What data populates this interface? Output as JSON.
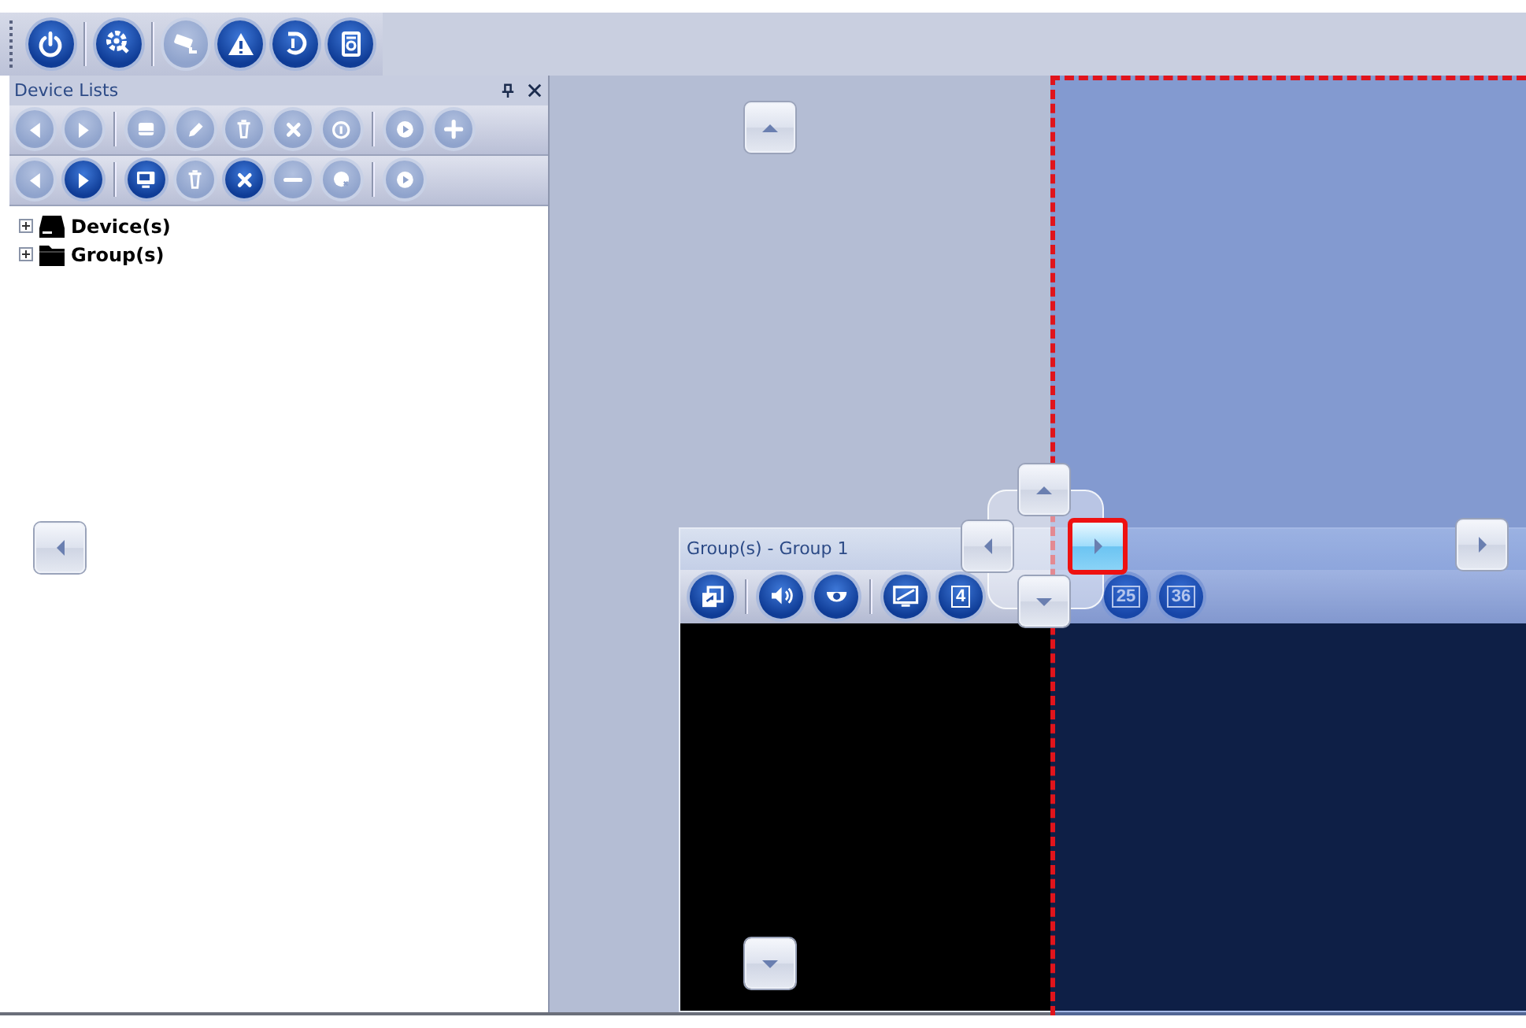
{
  "main_toolbar": {
    "groups": [
      {
        "buttons": [
          {
            "kind": "power",
            "disabled": false
          }
        ]
      },
      {
        "buttons": [
          {
            "kind": "settings",
            "disabled": false
          }
        ]
      },
      {
        "buttons": [
          {
            "kind": "camera",
            "disabled": true
          },
          {
            "kind": "warning",
            "disabled": false
          },
          {
            "kind": "playback",
            "disabled": false
          },
          {
            "kind": "disk",
            "disabled": false
          }
        ]
      }
    ]
  },
  "device_panel": {
    "title": "Device Lists",
    "toolbars": [
      {
        "groups": [
          {
            "buttons": [
              {
                "kind": "prev",
                "disabled": true
              },
              {
                "kind": "next",
                "disabled": true
              }
            ]
          },
          {
            "buttons": [
              {
                "kind": "device",
                "disabled": true
              },
              {
                "kind": "edit",
                "disabled": true
              },
              {
                "kind": "delete",
                "disabled": true
              },
              {
                "kind": "close",
                "disabled": true
              },
              {
                "kind": "info",
                "disabled": true
              }
            ]
          },
          {
            "buttons": [
              {
                "kind": "play",
                "disabled": true
              },
              {
                "kind": "add",
                "disabled": true
              }
            ]
          }
        ]
      },
      {
        "groups": [
          {
            "buttons": [
              {
                "kind": "prev",
                "disabled": true
              },
              {
                "kind": "next",
                "disabled": false
              }
            ]
          },
          {
            "buttons": [
              {
                "kind": "monitor",
                "disabled": false
              },
              {
                "kind": "delete",
                "disabled": true
              },
              {
                "kind": "close",
                "disabled": false
              },
              {
                "kind": "minus",
                "disabled": true
              },
              {
                "kind": "remove",
                "disabled": true
              }
            ]
          },
          {
            "buttons": [
              {
                "kind": "play",
                "disabled": true
              }
            ]
          }
        ]
      }
    ],
    "tree": [
      {
        "label": "Device(s)",
        "kind": "device",
        "expanded": false
      },
      {
        "label": "Group(s)",
        "kind": "folder",
        "expanded": false
      }
    ]
  },
  "group_window": {
    "title": "Group(s) - Group 1",
    "toolbar": {
      "groups": [
        {
          "buttons": [
            {
              "kind": "fullscreen",
              "disabled": false
            }
          ]
        },
        {
          "buttons": [
            {
              "kind": "sound",
              "disabled": false
            },
            {
              "kind": "dome",
              "disabled": false
            }
          ]
        },
        {
          "buttons": [
            {
              "kind": "screen",
              "disabled": false
            },
            {
              "kind": "grid",
              "label": "4",
              "disabled": false
            },
            {
              "kind": "hidden"
            },
            {
              "kind": "grid",
              "label": "25",
              "disabled": false
            },
            {
              "kind": "grid",
              "label": "36",
              "disabled": false
            }
          ]
        }
      ]
    }
  },
  "dock_guides": {
    "outer": {
      "up": {
        "selected": false
      },
      "left": {
        "selected": false
      },
      "down": {
        "selected": false
      },
      "right": {
        "selected": false
      }
    },
    "center": {
      "up": {
        "selected": false
      },
      "left": {
        "selected": false
      },
      "down": {
        "selected": false
      },
      "right": {
        "selected": true
      }
    }
  }
}
